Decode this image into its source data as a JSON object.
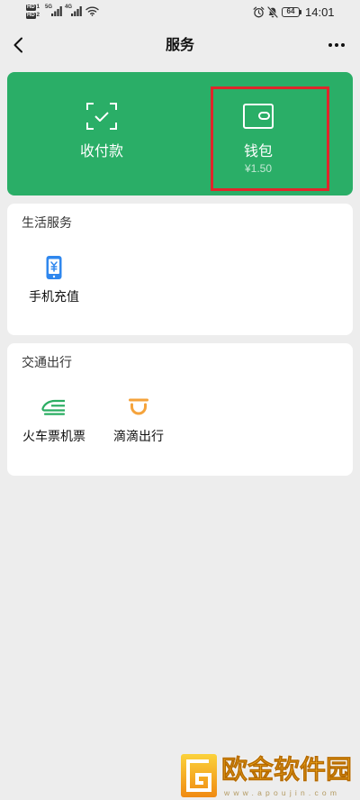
{
  "status_bar": {
    "sim_badges": [
      {
        "label": "HD",
        "slot": "1"
      },
      {
        "label": "HD",
        "slot": "2"
      }
    ],
    "networks": [
      "5G",
      "4G"
    ],
    "battery": "64",
    "time": "14:01",
    "icons": [
      "signal-icon",
      "wifi-icon",
      "alarm-icon",
      "mute-icon",
      "battery-icon"
    ]
  },
  "nav": {
    "title": "服务",
    "back_icon": "back-icon",
    "more_icon": "more-icon"
  },
  "pay_card": {
    "items": [
      {
        "label": "收付款",
        "icon": "scan-check-icon"
      },
      {
        "label": "钱包",
        "sub": "¥1.50",
        "icon": "wallet-icon",
        "highlighted": true
      }
    ]
  },
  "sections": [
    {
      "title": "生活服务",
      "items": [
        {
          "label": "手机充值",
          "icon": "phone-recharge-icon"
        }
      ]
    },
    {
      "title": "交通出行",
      "items": [
        {
          "label": "火车票机票",
          "icon": "train-icon"
        },
        {
          "label": "滴滴出行",
          "icon": "didi-icon"
        }
      ]
    }
  ],
  "watermark": {
    "text": "欧金软件园",
    "url": "www.apoujin.com",
    "icon": "watermark-logo-icon"
  },
  "colors": {
    "page_bg": "#ededed",
    "green": "#2aae67",
    "highlight": "#e0262b",
    "phone_icon": "#2f87ee",
    "train_icon": "#2aad62",
    "didi_icon": "#f5a33b",
    "watermark": "#f4ad1f"
  }
}
